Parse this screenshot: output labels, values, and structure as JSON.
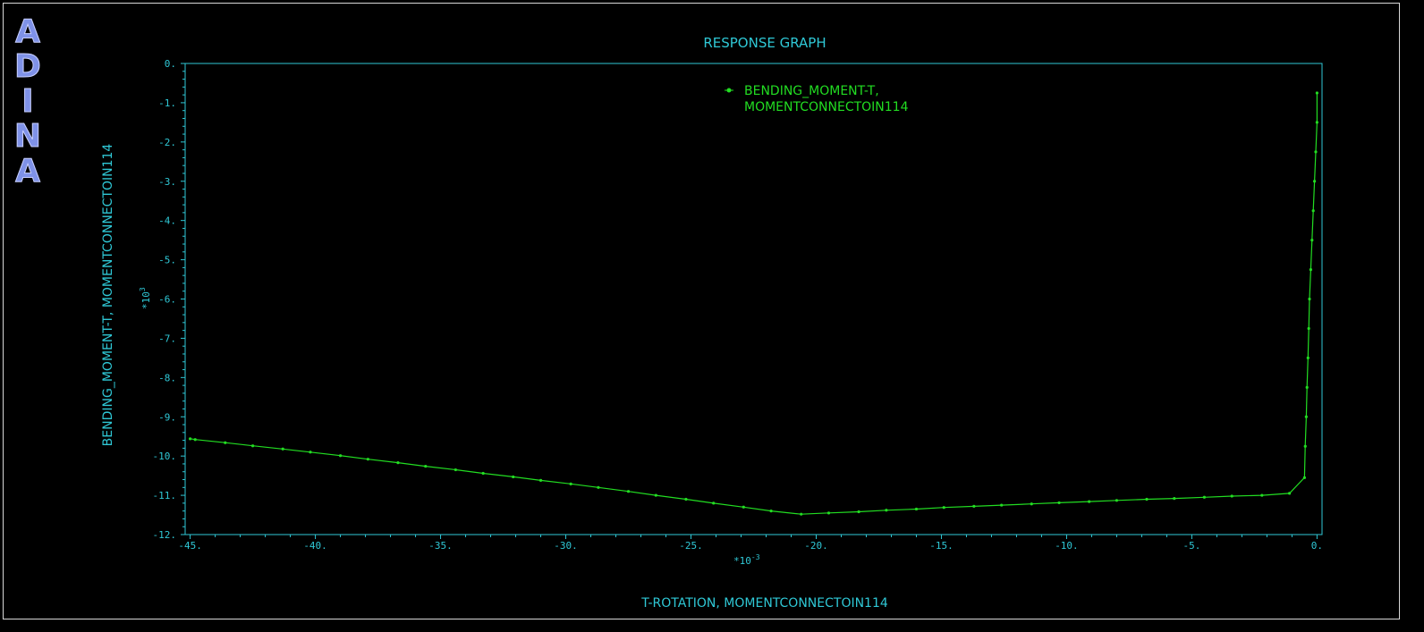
{
  "logo": {
    "letters": [
      "A",
      "D",
      "I",
      "N",
      "A"
    ]
  },
  "chart_data": {
    "type": "line",
    "title": "RESPONSE GRAPH",
    "xlabel": "T-ROTATION, MOMENTCONNECTOIN114",
    "ylabel": "BENDING_MOMENT-T, MOMENTCONNECTOIN114",
    "x_multiplier": "*10",
    "x_multiplier_exp": "-3",
    "y_multiplier": "*10",
    "y_multiplier_exp": "3",
    "xlim": [
      -45.2,
      0.2
    ],
    "ylim": [
      -12,
      0
    ],
    "x_ticks": [
      -45,
      -40,
      -35,
      -30,
      -25,
      -20,
      -15,
      -10,
      -5,
      0
    ],
    "x_tick_labels": [
      "-45.",
      "-40.",
      "-35.",
      "-30.",
      "-25.",
      "-20.",
      "-15.",
      "-10.",
      "-5.",
      "0."
    ],
    "y_ticks": [
      0,
      -1,
      -2,
      -3,
      -4,
      -5,
      -6,
      -7,
      -8,
      -9,
      -10,
      -11,
      -12
    ],
    "y_tick_labels": [
      "0.",
      "-1.",
      "-2.",
      "-3.",
      "-4.",
      "-5.",
      "-6.",
      "-7.",
      "-8.",
      "-9.",
      "-10.",
      "-11.",
      "-12."
    ],
    "legend_position": "top-center",
    "series": [
      {
        "name": "BENDING_MOMENT-T, MOMENTCONNECTOIN114",
        "name_lines": [
          "BENDING_MOMENT-T,",
          "MOMENTCONNECTOIN114"
        ],
        "color": "#22dd22",
        "points": [
          [
            0.0,
            -0.75
          ],
          [
            0.0,
            -1.5
          ],
          [
            -0.05,
            -2.25
          ],
          [
            -0.1,
            -3.0
          ],
          [
            -0.15,
            -3.75
          ],
          [
            -0.2,
            -4.5
          ],
          [
            -0.25,
            -5.25
          ],
          [
            -0.3,
            -6.0
          ],
          [
            -0.33,
            -6.75
          ],
          [
            -0.36,
            -7.5
          ],
          [
            -0.4,
            -8.25
          ],
          [
            -0.43,
            -9.0
          ],
          [
            -0.47,
            -9.75
          ],
          [
            -0.5,
            -10.55
          ],
          [
            -1.1,
            -10.95
          ],
          [
            -2.2,
            -11.0
          ],
          [
            -3.4,
            -11.02
          ],
          [
            -4.5,
            -11.05
          ],
          [
            -5.7,
            -11.08
          ],
          [
            -6.8,
            -11.1
          ],
          [
            -8.0,
            -11.13
          ],
          [
            -9.1,
            -11.16
          ],
          [
            -10.3,
            -11.19
          ],
          [
            -11.4,
            -11.22
          ],
          [
            -12.6,
            -11.25
          ],
          [
            -13.7,
            -11.28
          ],
          [
            -14.9,
            -11.31
          ],
          [
            -16.0,
            -11.35
          ],
          [
            -17.2,
            -11.38
          ],
          [
            -18.3,
            -11.42
          ],
          [
            -19.5,
            -11.45
          ],
          [
            -20.6,
            -11.48
          ],
          [
            -21.8,
            -11.4
          ],
          [
            -22.9,
            -11.3
          ],
          [
            -24.1,
            -11.2
          ],
          [
            -25.2,
            -11.1
          ],
          [
            -26.4,
            -11.0
          ],
          [
            -27.5,
            -10.9
          ],
          [
            -28.7,
            -10.8
          ],
          [
            -29.8,
            -10.71
          ],
          [
            -31.0,
            -10.62
          ],
          [
            -32.1,
            -10.53
          ],
          [
            -33.3,
            -10.44
          ],
          [
            -34.4,
            -10.35
          ],
          [
            -35.6,
            -10.26
          ],
          [
            -36.7,
            -10.17
          ],
          [
            -37.9,
            -10.08
          ],
          [
            -39.0,
            -9.99
          ],
          [
            -40.2,
            -9.9
          ],
          [
            -41.3,
            -9.82
          ],
          [
            -42.5,
            -9.74
          ],
          [
            -43.6,
            -9.66
          ],
          [
            -44.8,
            -9.58
          ],
          [
            -45.0,
            -9.56
          ]
        ]
      }
    ]
  }
}
